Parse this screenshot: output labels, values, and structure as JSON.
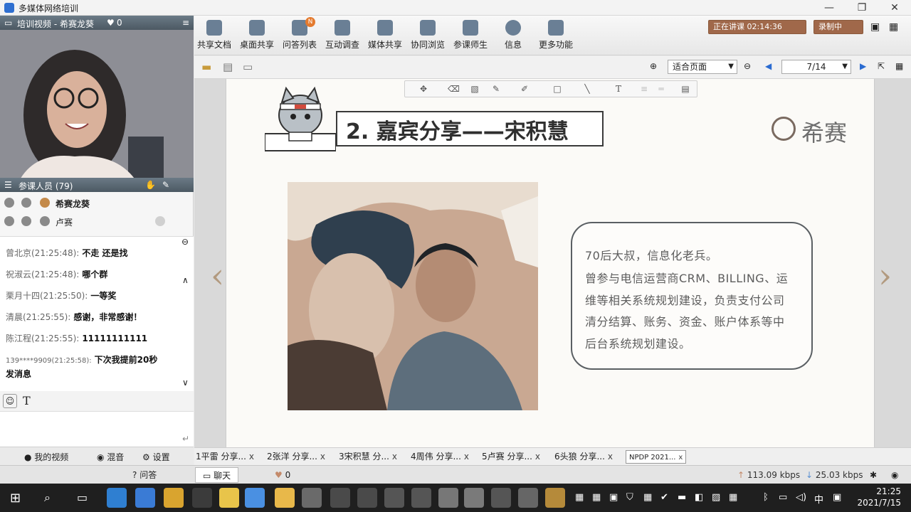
{
  "window": {
    "title": "多媒体网络培训",
    "controls": [
      "—",
      "❐",
      "✕"
    ]
  },
  "left": {
    "video_header": {
      "title": "培训视频 - 希赛龙葵",
      "likes": "0"
    },
    "participants_header": {
      "title": "参课人员 (79)"
    },
    "participants": [
      {
        "name": "希赛龙葵"
      },
      {
        "name": "卢赛"
      }
    ],
    "chat": [
      {
        "who": "曾北京(21:25:48):",
        "text": "不走 还是找"
      },
      {
        "who": "祝淑云(21:25:48):",
        "text": "哪个群"
      },
      {
        "who": "栗月十四(21:25:50):",
        "text": "一等奖"
      },
      {
        "who": "清晨(21:25:55):",
        "text": "感谢，非常感谢！"
      },
      {
        "who": "陈江程(21:25:55):",
        "text": "11111111111"
      },
      {
        "who": "139****9909(21:25:58):",
        "text": "下次我提前20秒"
      },
      {
        "who": "",
        "text": "发消息"
      }
    ],
    "bottom": {
      "my_video": "我的视频",
      "mix": "混音",
      "settings": "设置"
    }
  },
  "toolbar": {
    "buttons": [
      "共享文档",
      "桌面共享",
      "问答列表",
      "互动调查",
      "媒体共享",
      "协同浏览",
      "参课师生",
      "信息",
      "更多功能"
    ],
    "qa_badge": "N",
    "live_status": "正在讲课 02:14:36",
    "recording": "录制中",
    "fit_option": "适合页面",
    "page": "7/14"
  },
  "slide": {
    "title": "2. 嘉宾分享——宋积慧",
    "logo_text": "希赛",
    "bio": [
      "70后大叔，信息化老兵。",
      "曾参与电信运营商CRM、BILLING、运",
      "维等相关系统规划建设，负责支付公司",
      "清分结算、账务、资金、账户体系等中",
      "后台系统规划建设。"
    ]
  },
  "doc_tabs": [
    "1平雷 分享...",
    "2张洋 分享...",
    "3宋积慧 分...",
    "4周伟 分享...",
    "5卢赛 分享...",
    "6头狼 分享...",
    "NPDP 2021..."
  ],
  "status": {
    "qa": "问答",
    "chat": "聊天",
    "likes": "0",
    "upload": "113.09 kbps",
    "download": "25.03 kbps"
  },
  "taskbar": {
    "time": "21:25",
    "date": "2021/7/15",
    "ime": "中"
  },
  "colors": {
    "accent": "#a0684a",
    "slide_bg": "#fbfaf7",
    "bio_border": "#5a5f63"
  }
}
